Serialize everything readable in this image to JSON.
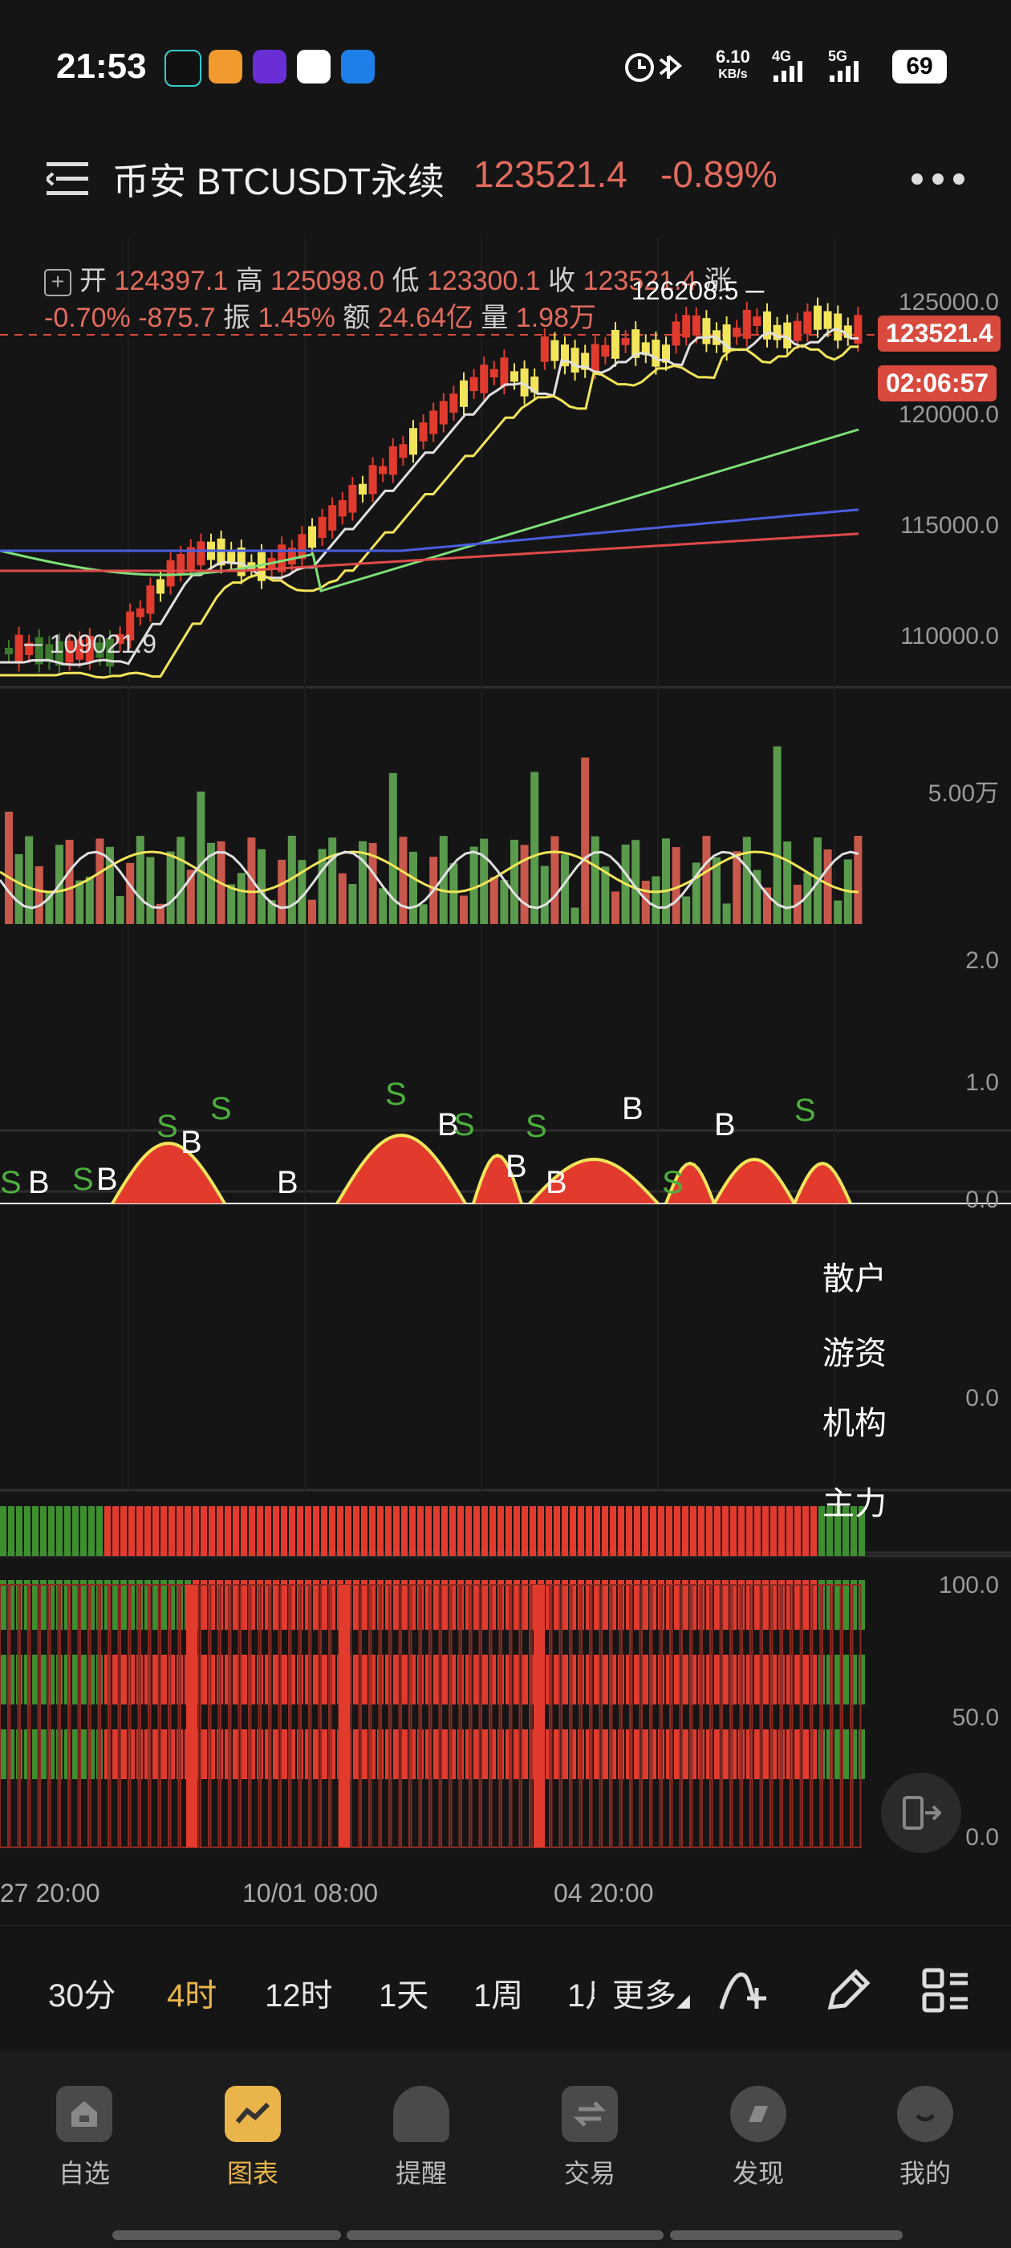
{
  "status": {
    "time": "21:53",
    "net_speed": "6.10",
    "net_unit": "KB/s",
    "net_4g": "4G",
    "net_5g": "5G",
    "battery": "69"
  },
  "header": {
    "title": "币安 BTCUSDT永续",
    "price": "123521.4",
    "change": "-0.89%"
  },
  "info": {
    "open_label": "开",
    "open": "124397.1",
    "high_label": "高",
    "high": "125098.0",
    "low_label": "低",
    "low": "123300.1",
    "close_label": "收",
    "close": "123521.4",
    "chg_label": "涨",
    "chg_pct": "-0.70%",
    "chg_abs": "-875.7",
    "amp_label": "振",
    "amp": "1.45%",
    "amount_label": "额",
    "amount": "24.64亿",
    "volume_label": "量",
    "volume": "1.98万"
  },
  "chart": {
    "high_marker": "126208.5",
    "low_marker": "109021.9",
    "price_tag": "123521.4",
    "countdown_tag": "02:06:57",
    "price_axis": [
      "125000.0",
      "120000.0",
      "115000.0",
      "110000.0"
    ],
    "volume_axis": "5.00万",
    "indicator_axis": [
      "2.0",
      "1.0",
      "0.0"
    ],
    "flow_axis": "0.0",
    "flow_labels": [
      "散户",
      "游资",
      "机构",
      "主力"
    ],
    "bar_axis": [
      "100.0",
      "50.0",
      "0.0"
    ],
    "time_axis": [
      "27 20:00",
      "10/01 08:00",
      "04 20:00"
    ],
    "signals": [
      {
        "t": "S",
        "color": "#4caf3c"
      },
      {
        "t": "B",
        "color": "#ffffff"
      },
      {
        "t": "S",
        "color": "#4caf3c"
      },
      {
        "t": "B",
        "color": "#ffffff"
      },
      {
        "t": "S",
        "color": "#4caf3c"
      },
      {
        "t": "B",
        "color": "#ffffff"
      },
      {
        "t": "S",
        "color": "#4caf3c"
      },
      {
        "t": "B",
        "color": "#ffffff"
      },
      {
        "t": "S",
        "color": "#4caf3c"
      },
      {
        "t": "B",
        "color": "#ffffff"
      },
      {
        "t": "S",
        "color": "#4caf3c"
      },
      {
        "t": "B",
        "color": "#ffffff"
      },
      {
        "t": "S",
        "color": "#4caf3c"
      },
      {
        "t": "B",
        "color": "#ffffff"
      },
      {
        "t": "B",
        "color": "#ffffff"
      },
      {
        "t": "S",
        "color": "#4caf3c"
      },
      {
        "t": "B",
        "color": "#ffffff"
      },
      {
        "t": "S",
        "color": "#4caf3c"
      }
    ]
  },
  "timeframes": [
    {
      "label": "30分",
      "active": false
    },
    {
      "label": "4时",
      "active": true
    },
    {
      "label": "12时",
      "active": false
    },
    {
      "label": "1天",
      "active": false
    },
    {
      "label": "1周",
      "active": false
    },
    {
      "label": "1月",
      "active": false
    }
  ],
  "more_label": "更多",
  "nav": [
    {
      "label": "自选",
      "icon": "watchlist-icon",
      "active": false
    },
    {
      "label": "图表",
      "icon": "chart-icon",
      "active": true
    },
    {
      "label": "提醒",
      "icon": "bell-icon",
      "active": false
    },
    {
      "label": "交易",
      "icon": "trade-icon",
      "active": false
    },
    {
      "label": "发现",
      "icon": "discover-icon",
      "active": false
    },
    {
      "label": "我的",
      "icon": "profile-icon",
      "active": false
    }
  ],
  "colors": {
    "up": "#e23b2e",
    "down": "#4a8c3a",
    "accent": "#e9b54a",
    "ma_white": "#e0e0e0",
    "ma_yellow": "#f2e55a",
    "ma_green": "#7fe07a",
    "ma_blue": "#4a5ee0",
    "ma_red": "#e04a4a"
  }
}
